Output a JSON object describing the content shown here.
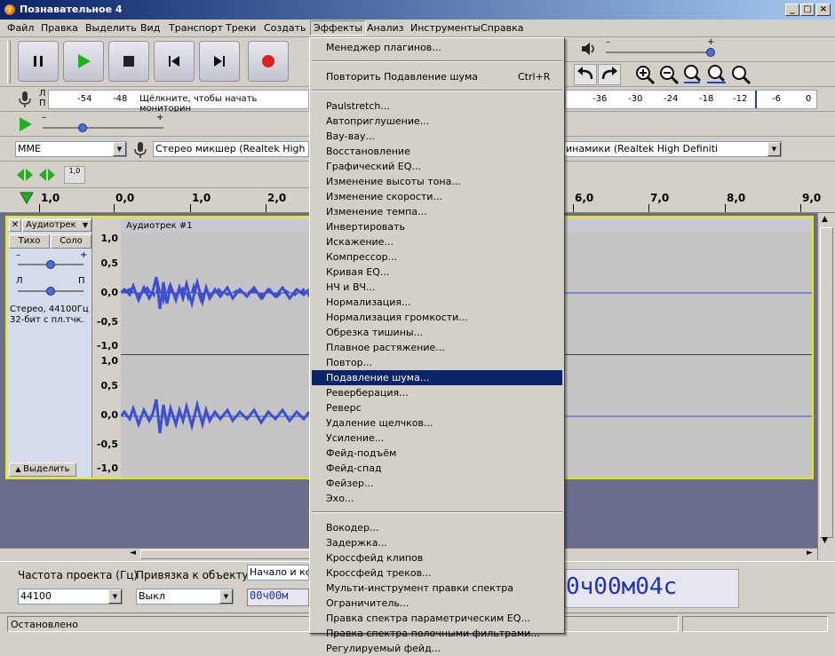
{
  "window": {
    "title": "Познавательное 4"
  },
  "menubar": [
    "Файл",
    "Правка",
    "Выделить",
    "Вид",
    "Транспорт",
    "Треки",
    "Создать",
    "Эффекты",
    "Анализ",
    "Инструменты",
    "Справка"
  ],
  "meter_rec": {
    "labels": [
      "-54",
      "-48"
    ],
    "lr": [
      "Л",
      "П"
    ],
    "hint": "Щёлкните, чтобы начать мониторин"
  },
  "meter_play": {
    "labels": [
      "-36",
      "-30",
      "-24",
      "-18",
      "-12",
      "-6",
      "0"
    ]
  },
  "devices": {
    "host": "MME",
    "input": "Стерео микшер (Realtek High Def",
    "output": "инамики (Realtek High Definiti"
  },
  "edit_toolbar": {
    "zoom_label": "1,0"
  },
  "ruler": {
    "ticks": [
      "1,0",
      "0,0",
      "1,0",
      "2,0",
      "6,0",
      "7,0",
      "8,0",
      "9,0"
    ]
  },
  "track": {
    "name": "Аудиотрек",
    "clip_name": "Аудиотрек #1",
    "close": "✕",
    "mute": "Тихо",
    "solo": "Соло",
    "gain_minus": "–",
    "gain_plus": "+",
    "pan_l": "Л",
    "pan_r": "П",
    "info1": "Стерео, 44100Гц",
    "info2": "32-бит с пл.тчк.",
    "select": "Выделить",
    "scale": [
      "1,0",
      "0,5",
      "0,0",
      "-0,5",
      "-1,0"
    ]
  },
  "selection_bar": {
    "rate_label": "Частота проекта (Гц)",
    "rate_value": "44100",
    "snap_label": "Привязка к объекту",
    "snap_value": "Выкл",
    "range_label": "Начало и кон",
    "small_time": "00ч00м",
    "big_time": "0ч00м04с"
  },
  "status": {
    "text": "Остановлено"
  },
  "effects_menu": {
    "group1": [
      "Менеджер плагинов..."
    ],
    "repeat": {
      "label": "Повторить Подавление шума",
      "shortcut": "Ctrl+R"
    },
    "group2": [
      "Paulstretch...",
      "Автоприглушение...",
      "Вау-вау...",
      "Восстановление",
      "Графический EQ...",
      "Изменение высоты тона...",
      "Изменение скорости...",
      "Изменение темпа...",
      "Инвертировать",
      "Искажение...",
      "Компрессор...",
      "Кривая EQ...",
      "НЧ и ВЧ...",
      "Нормализация...",
      "Нормализация громкости...",
      "Обрезка тишины...",
      "Плавное растяжение...",
      "Повтор...",
      "Подавление шума...",
      "Реверберация...",
      "Реверс",
      "Удаление щелчков...",
      "Усиление...",
      "Фейд-подъём",
      "Фейд-спад",
      "Фейзер...",
      "Эхо..."
    ],
    "group3": [
      "Вокодер...",
      "Задержка...",
      "Кроссфейд клипов",
      "Кроссфейд треков...",
      "Мульти-инструмент правки спектра",
      "Ограничитель...",
      "Правка спектра параметрическим EQ...",
      "Правка спектра полочными фильтрами...",
      "Регулируемый фейд..."
    ],
    "highlighted": "Подавление шума..."
  },
  "colors": {
    "accent": "#0a246a",
    "wave": "#3d4fd0",
    "track_border": "#e8e800"
  }
}
